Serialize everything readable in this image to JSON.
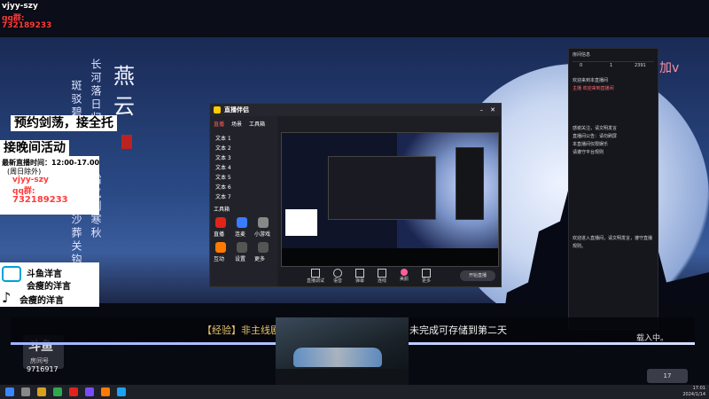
{
  "overlay": {
    "top_left_qq": "vjyy-szy",
    "top_left_qq_label": "qq群:",
    "top_left_qq_number": "732189233",
    "banner1": "预约剑荡，接全托",
    "banner2": "接晚间活动",
    "schedule": "最新直播时间：12:00-17.00",
    "schedule_note": "(周日除外)",
    "wechat": "vjyy-szy",
    "qq_label": "qq群:",
    "qq_number": "732189233",
    "bili_label": "斗鱼洋言",
    "bili_label2": "会瘦的洋言",
    "tiktok_label": "会瘦的洋言",
    "douyu_logo": "斗鱼",
    "room_label": "房间号",
    "room_number": "9716917"
  },
  "scene": {
    "title_char1": "燕",
    "title_char2": "云",
    "poem_col1": "长河落日归",
    "poem_col2": "斑驳碧",
    "poem_col3": "万里黄沙葬关钩",
    "poem_col4": "霜气冽寒秋",
    "caption_prefix": "【经验】非主线剧",
    "caption_suffix": "未完成可存储到第二天",
    "loading": "载入中。",
    "side_tag": "加v"
  },
  "obs": {
    "app_name": "直播伴侣",
    "tab_live": "直播",
    "tab_scene": "场景",
    "tab_tools": "工具箱",
    "source_items": [
      "文本 1",
      "文本 2",
      "文本 3",
      "文本 4",
      "文本 5",
      "文本 6",
      "文本 7"
    ],
    "tool_section": "工具箱",
    "toolbar": [
      "直播调试",
      "语音",
      "弹幕",
      "连线",
      "美颜",
      "更多"
    ],
    "start_button": "开始直播",
    "tool_icons": [
      "直播",
      "连麦",
      "小游戏",
      "互动",
      "设置",
      "更多"
    ]
  },
  "chat": {
    "header": "房间信息",
    "stats": [
      "0",
      "1",
      "2391"
    ],
    "messages": [
      "欢迎来到本直播间",
      "主播 欢迎来到直播间",
      "感谢关注，请文明发言",
      "直播间公告：请勿刷屏",
      "本直播间仅限娱乐",
      "请遵守平台规则"
    ],
    "notice": "欢迎进入直播间，请文明发言，遵守直播规则。"
  },
  "taskbar": {
    "time": "17:01",
    "date": "2024/1/14"
  },
  "colors": {
    "accent_red": "#e2231a",
    "caption_gold": "#e8c46a",
    "douyu_orange": "#ff7a00"
  }
}
